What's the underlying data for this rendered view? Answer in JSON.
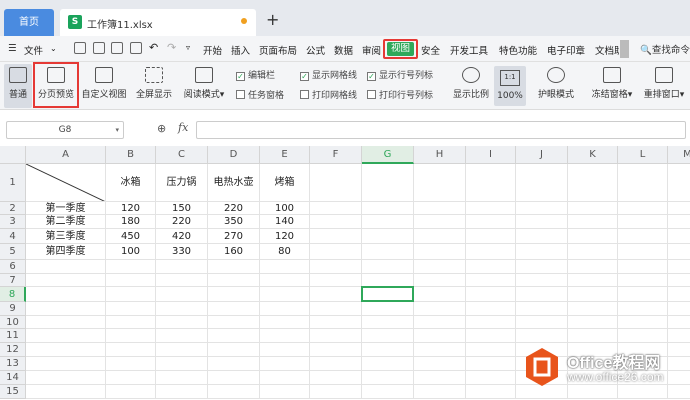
{
  "tabs": {
    "home_label": "首页",
    "file_label": "工作簿11.xlsx",
    "file_icon_letter": "S"
  },
  "menu": {
    "file_label": "文件",
    "items": [
      "开始",
      "插入",
      "页面布局",
      "公式",
      "数据",
      "审阅",
      "视图",
      "安全",
      "开发工具",
      "特色功能",
      "电子印章",
      "文档助"
    ],
    "active": "视图",
    "search_label": "查找命令"
  },
  "ribbon": {
    "normal": "普通",
    "page_preview": "分页预览",
    "custom_view": "自定义视图",
    "full_screen": "全屏显示",
    "reading_mode": "阅读模式",
    "checks": [
      {
        "label": "编辑栏",
        "checked": true
      },
      {
        "label": "任务窗格",
        "checked": false
      },
      {
        "label": "显示网格线",
        "checked": true
      },
      {
        "label": "打印网格线",
        "checked": false
      },
      {
        "label": "显示行号列标",
        "checked": true
      },
      {
        "label": "打印行号列标",
        "checked": false
      }
    ],
    "zoom_ratio": "显示比例",
    "zoom_100": "100%",
    "eye_mode": "护眼模式",
    "freeze": "冻结窗格",
    "rearrange": "重排窗口"
  },
  "formula_bar": {
    "cell_ref": "G8",
    "fx": "fx",
    "value": ""
  },
  "sheet": {
    "columns": [
      "A",
      "B",
      "C",
      "D",
      "E",
      "F",
      "G",
      "H",
      "I",
      "J",
      "K",
      "L",
      "M"
    ],
    "rows": [
      "1",
      "2",
      "3",
      "4",
      "5",
      "6",
      "7",
      "8",
      "9",
      "10",
      "11",
      "12",
      "13",
      "14",
      "15"
    ],
    "selected_column": "G",
    "selected_row": "8",
    "header_row": [
      "",
      "冰箱",
      "压力锅",
      "电热水壶",
      "烤箱"
    ],
    "data_rows": [
      [
        "第一季度",
        "120",
        "150",
        "220",
        "100"
      ],
      [
        "第二季度",
        "180",
        "220",
        "350",
        "140"
      ],
      [
        "第三季度",
        "450",
        "420",
        "270",
        "120"
      ],
      [
        "第四季度",
        "100",
        "330",
        "160",
        "80"
      ]
    ]
  },
  "watermark": {
    "title": "Office教程网",
    "url": "www.office26.com",
    "accent": "#e8541b"
  },
  "colors": {
    "accent_green": "#2fa85a",
    "highlight_red": "#e53935",
    "home_tab_blue": "#4a8be0"
  }
}
